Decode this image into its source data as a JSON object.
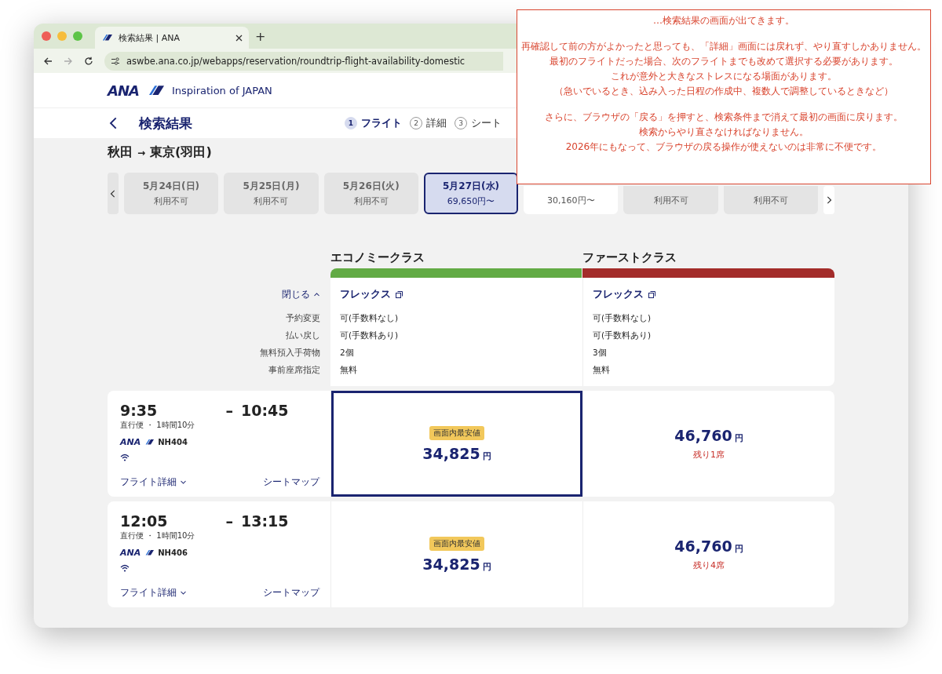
{
  "browser": {
    "tab_title": "検索結果 | ANA",
    "new_tab": "+",
    "url": "aswbe.ana.co.jp/webapps/reservation/roundtrip-flight-availability-domestic"
  },
  "header": {
    "logo": "ANA",
    "tagline": "Inspiration of JAPAN"
  },
  "nav": {
    "title": "検索結果",
    "steps": [
      {
        "number": "1",
        "label": "フライト",
        "selected": true
      },
      {
        "number": "2",
        "label": "詳細",
        "selected": false
      },
      {
        "number": "3",
        "label": "シート",
        "selected": false
      }
    ]
  },
  "route": {
    "from": "秋田",
    "arrow": "→",
    "to": "東京(羽田)"
  },
  "dates": [
    {
      "date": "5月24日(日)",
      "status": "利用不可",
      "available": false,
      "selected": false
    },
    {
      "date": "5月25日(月)",
      "status": "利用不可",
      "available": false,
      "selected": false
    },
    {
      "date": "5月26日(火)",
      "status": "利用不可",
      "available": false,
      "selected": false
    },
    {
      "date": "5月27日(水)",
      "status": "69,650円〜",
      "available": true,
      "selected": true
    },
    {
      "status": "30,160円〜",
      "available": true,
      "selected": false
    },
    {
      "status": "利用不可",
      "available": false,
      "selected": false
    },
    {
      "status": "利用不可",
      "available": false,
      "selected": false
    }
  ],
  "fare_table": {
    "toggle": "閉じる",
    "labels": [
      "予約変更",
      "払い戻し",
      "無料預入手荷物",
      "事前座席指定"
    ],
    "classes": [
      {
        "name": "エコノミークラス",
        "color": "#62ab45",
        "fare_name": "フレックス",
        "values": [
          "可(手数料なし)",
          "可(手数料あり)",
          "2個",
          "無料"
        ]
      },
      {
        "name": "ファーストクラス",
        "color": "#a32c2a",
        "fare_name": "フレックス",
        "values": [
          "可(手数料なし)",
          "可(手数料あり)",
          "3個",
          "無料"
        ]
      }
    ]
  },
  "flights": [
    {
      "depart": "9:35",
      "dash": "–",
      "arrive": "10:45",
      "info": "直行便 ・ 1時間10分",
      "airline": "ANA",
      "flight_no": "NH404",
      "detail_link": "フライト詳細",
      "seatmap_link": "シートマップ",
      "fares": [
        {
          "badge": "画面内最安値",
          "price": "34,825",
          "unit": "円",
          "selected": true
        },
        {
          "price": "46,760",
          "unit": "円",
          "note": "残り1席",
          "selected": false
        }
      ]
    },
    {
      "depart": "12:05",
      "dash": "–",
      "arrive": "13:15",
      "info": "直行便 ・ 1時間10分",
      "airline": "ANA",
      "flight_no": "NH406",
      "detail_link": "フライト詳細",
      "seatmap_link": "シートマップ",
      "fares": [
        {
          "badge": "画面内最安値",
          "price": "34,825",
          "unit": "円",
          "selected": false
        },
        {
          "price": "46,760",
          "unit": "円",
          "note": "残り4席",
          "selected": false
        }
      ]
    }
  ],
  "annotation": {
    "paragraphs": [
      [
        "…検索結果の画面が出てきます。"
      ],
      [
        "再確認して前の方がよかったと思っても、「詳細」画面には戻れず、やり直すしかありません。",
        "最初のフライトだった場合、次のフライトまでも改めて選択する必要があります。",
        "これが意外と大きなストレスになる場面があります。",
        "（急いでいるとき、込み入った日程の作成中、複数人で調整しているときなど）"
      ],
      [
        "さらに、ブラウザの「戻る」を押すと、検索条件まで消えて最初の画面に戻ります。",
        "検索からやり直さなければなりません。",
        "2026年にもなって、ブラウザの戻る操作が使えないのは非常に不便です。"
      ]
    ]
  }
}
